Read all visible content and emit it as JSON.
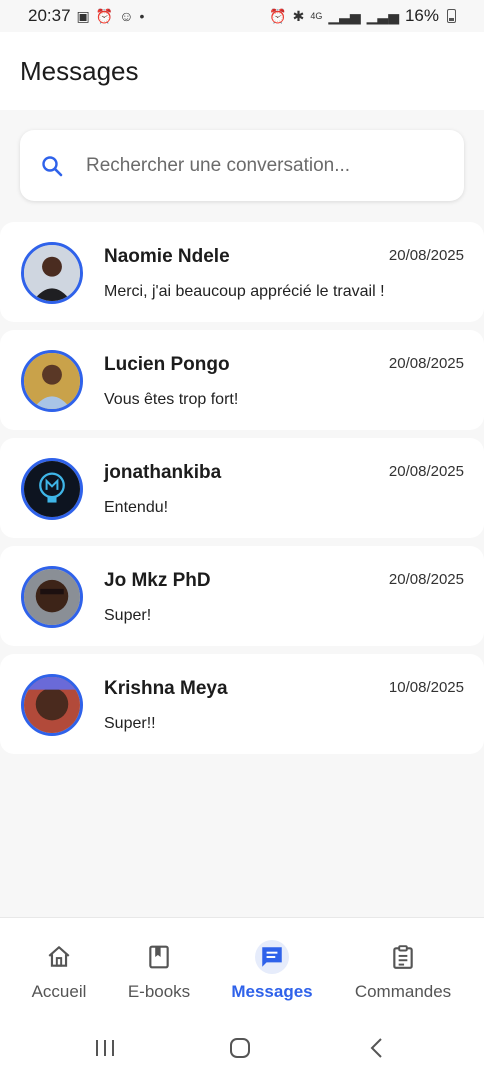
{
  "status_bar": {
    "time": "20:37",
    "battery": "16%",
    "left_icons": [
      "gallery-icon",
      "alarm-icon",
      "emoji-icon",
      "dot-icon"
    ],
    "right_icons": [
      "alarm-icon",
      "bluetooth-icon",
      "4g-icon",
      "signal-icon",
      "signal-icon",
      "battery-icon"
    ]
  },
  "header": {
    "title": "Messages"
  },
  "search": {
    "placeholder": "Rechercher une conversation...",
    "value": ""
  },
  "conversations": [
    {
      "name": "Naomie Ndele",
      "date": "20/08/2025",
      "message": "Merci, j'ai beaucoup apprécié le travail !"
    },
    {
      "name": "Lucien Pongo",
      "date": "20/08/2025",
      "message": "Vous êtes trop fort!"
    },
    {
      "name": "jonathankiba",
      "date": "20/08/2025",
      "message": "Entendu!"
    },
    {
      "name": "Jo Mkz PhD",
      "date": "20/08/2025",
      "message": "Super!"
    },
    {
      "name": "Krishna Meya",
      "date": "10/08/2025",
      "message": "Super!!"
    }
  ],
  "bottom_nav": {
    "items": [
      {
        "label": "Accueil",
        "icon": "home-icon",
        "active": false
      },
      {
        "label": "E-books",
        "icon": "book-icon",
        "active": false
      },
      {
        "label": "Messages",
        "icon": "message-icon",
        "active": true
      },
      {
        "label": "Commandes",
        "icon": "clipboard-icon",
        "active": false
      }
    ]
  },
  "colors": {
    "accent": "#2f62ea",
    "background": "#f7f7f7",
    "card": "#ffffff"
  }
}
